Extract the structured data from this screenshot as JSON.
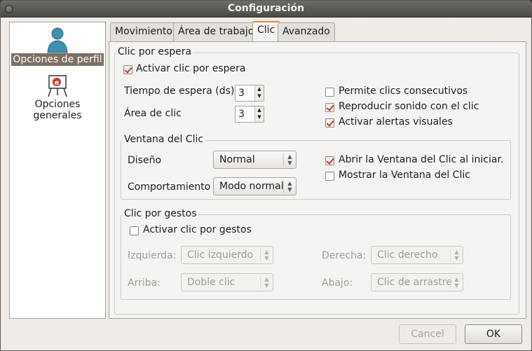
{
  "window": {
    "title": "Configuración"
  },
  "sidebar": {
    "items": [
      {
        "label": "Opciones de perfil",
        "icon": "person-icon",
        "selected": true
      },
      {
        "label": "Opciones generales",
        "icon": "presentation-icon",
        "selected": false
      }
    ]
  },
  "tabs": [
    {
      "label": "Movimiento",
      "active": false
    },
    {
      "label": "Área de trabajo",
      "active": false
    },
    {
      "label": "Clic",
      "active": true
    },
    {
      "label": "Avanzado",
      "active": false
    }
  ],
  "dwell": {
    "frame_title": "Clic por espera",
    "enable_label": "Activar clic por espera",
    "enable_checked": true,
    "timeout_label": "Tiempo de espera (ds)",
    "timeout_value": "3",
    "area_label": "Área de clic",
    "area_value": "3",
    "consecutive_label": "Permite clics consecutivos",
    "consecutive_checked": false,
    "sound_label": "Reproducir sonido con el clic",
    "sound_checked": true,
    "visual_label": "Activar alertas visuales",
    "visual_checked": true
  },
  "clickwin": {
    "frame_title": "Ventana del Clic",
    "design_label": "Diseño",
    "design_value": "Normal",
    "behavior_label": "Comportamiento",
    "behavior_value": "Modo normal",
    "open_on_start_label": "Abrir la Ventana del Clic al iniciar.",
    "open_on_start_checked": true,
    "show_label": "Mostrar la Ventana del Clic",
    "show_checked": false
  },
  "gestures": {
    "frame_title": "Clic por gestos",
    "enable_label": "Activar clic por gestos",
    "enable_checked": false,
    "left_label": "Izquierda:",
    "left_value": "Clic izquierdo",
    "right_label": "Derecha:",
    "right_value": "Clic derecho",
    "up_label": "Arriba:",
    "up_value": "Doble clic",
    "down_label": "Abajo:",
    "down_value": "Clic de arrastre"
  },
  "buttons": {
    "cancel_label": "Cancel",
    "ok_label": "OK"
  },
  "colors": {
    "selection": "#7c6f64",
    "check_mark": "#c0392b",
    "tab_highlight": "#e88a3c"
  }
}
